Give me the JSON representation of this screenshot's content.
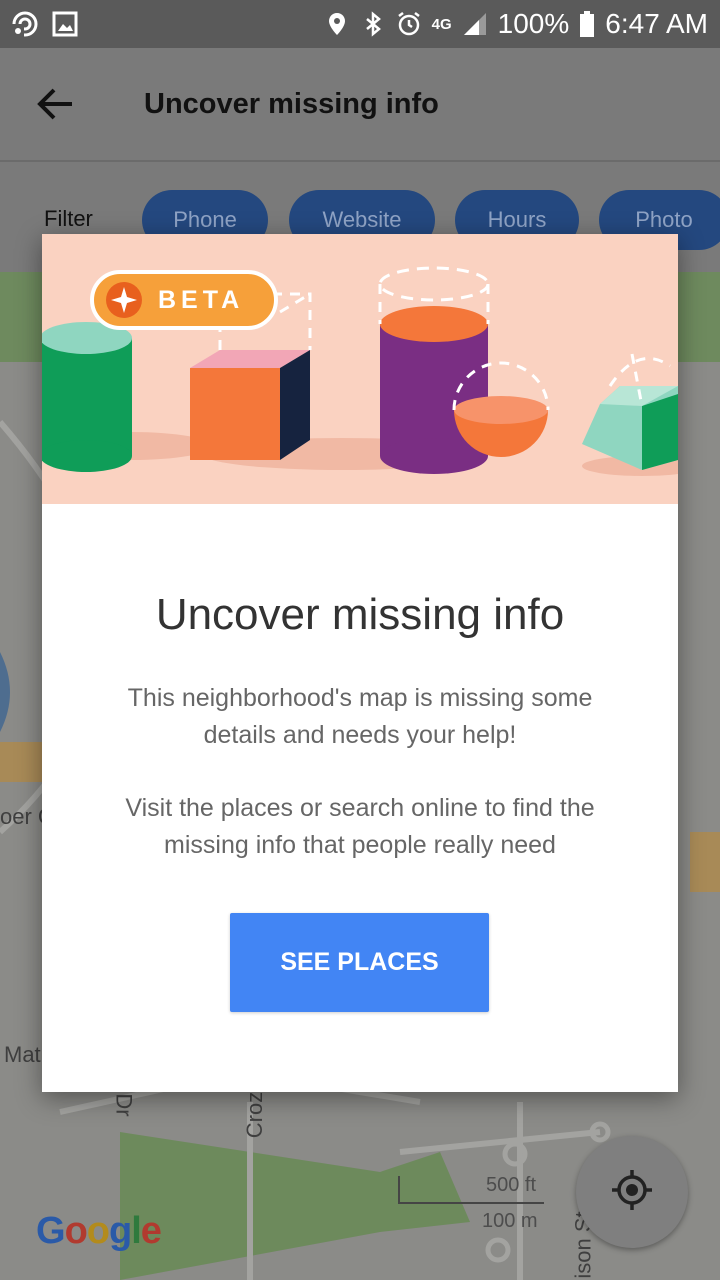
{
  "status_bar": {
    "battery": "100%",
    "time": "6:47 AM",
    "network": "4G",
    "icons": [
      "cast-icon",
      "image-icon",
      "location-icon",
      "bluetooth-icon",
      "alarm-icon",
      "signal-icon",
      "battery-icon"
    ]
  },
  "app_bar": {
    "title": "Uncover missing info",
    "back_icon": "arrow-back-icon"
  },
  "filter": {
    "label": "Filter",
    "chips": [
      "Phone",
      "Website",
      "Hours",
      "Photo"
    ]
  },
  "map": {
    "labels": [
      "oer C",
      "Mat",
      "Dr",
      "Croz",
      "ison St"
    ],
    "logo": "Google",
    "scale_ft": "500 ft",
    "scale_m": "100 m",
    "locate_icon": "my-location-icon"
  },
  "dialog": {
    "badge": "BETA",
    "title": "Uncover missing info",
    "paragraph1": "This neighborhood's map is missing some details and needs your help!",
    "paragraph2": "Visit the places or search online to find the missing info that people really need",
    "button": "SEE PLACES"
  },
  "colors": {
    "accent": "#4285f4",
    "banner_bg": "#fad2c1",
    "beta_badge": "#f6a03a",
    "chip_bg": "#24487f"
  }
}
